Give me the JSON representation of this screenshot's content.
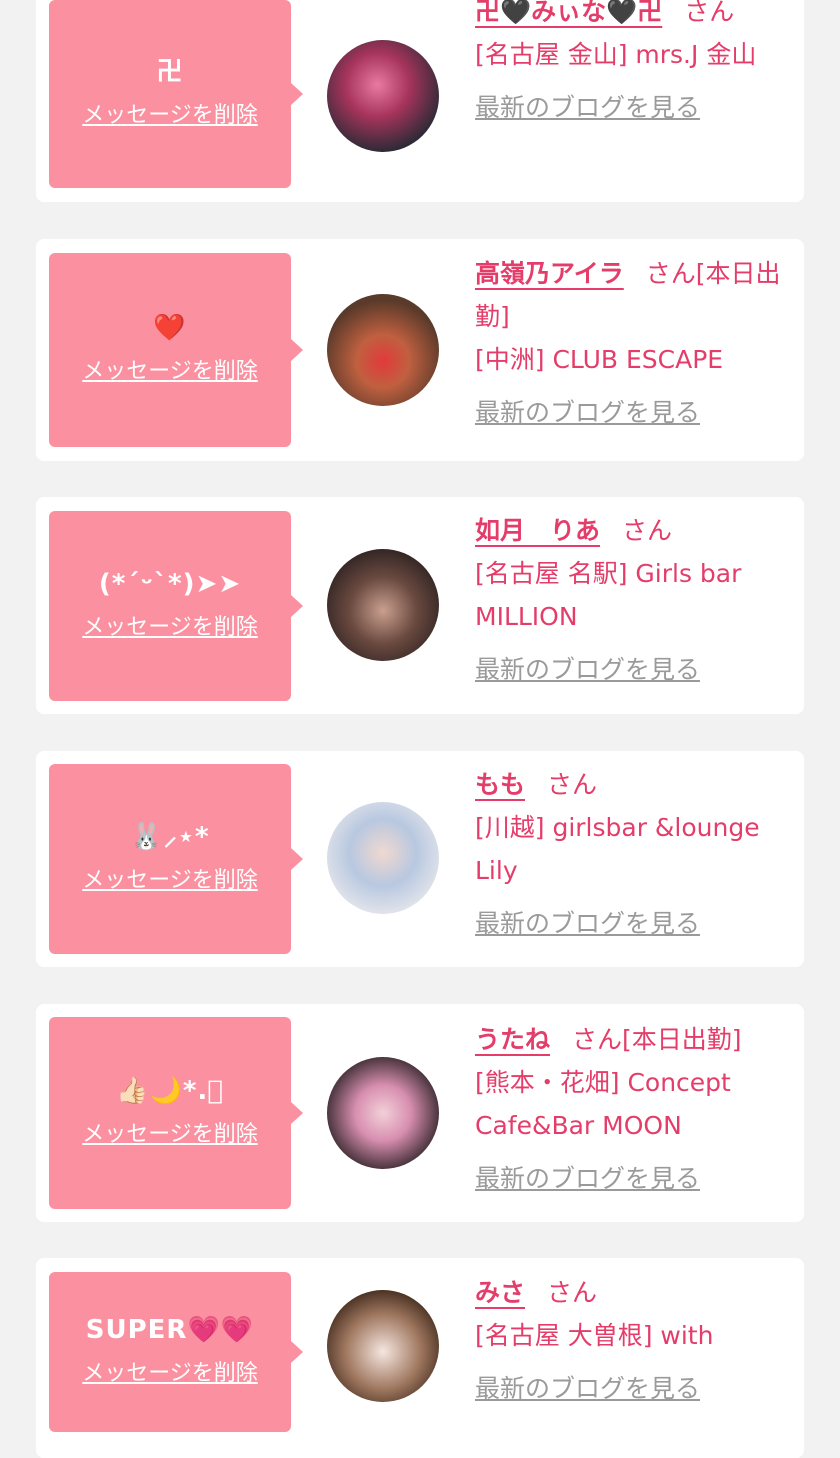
{
  "delete_label": "メッセージを削除",
  "blog_label": "最新のブログを見る",
  "san_label": "さん",
  "entries": [
    {
      "message": "卍",
      "name": "卍🖤みぃな🖤卍",
      "suffix": "",
      "shop": "[名古屋 金山] mrs.J 金山"
    },
    {
      "message": "❤️",
      "name": "高嶺乃アイラ",
      "suffix": "[本日出勤]",
      "shop": "[中洲] CLUB ESCAPE"
    },
    {
      "message": "(*ˊᵕˋ*)➤➤",
      "name": "如月　りあ",
      "suffix": "",
      "shop": "[名古屋 名駅] Girls bar MILLION"
    },
    {
      "message": "🐰⸝⋆*",
      "name": "もも",
      "suffix": "",
      "shop": "[川越] girlsbar &lounge Lily"
    },
    {
      "message": "👍🏻🌙*.ﾟ",
      "name": "うたね",
      "suffix": "[本日出勤]",
      "shop": "[熊本・花畑] Concept Cafe&Bar MOON"
    },
    {
      "message": "SUPER💗💗",
      "name": "みさ",
      "suffix": "",
      "shop": "[名古屋 大曽根] with"
    }
  ]
}
